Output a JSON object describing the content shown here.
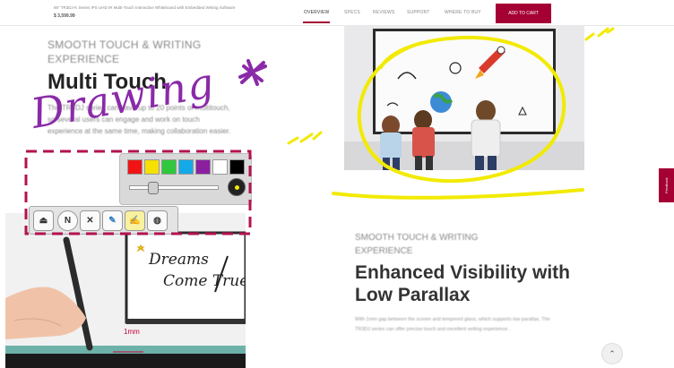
{
  "header": {
    "product_title": "86\" TR3DJ-K Series IPS UHD IR Multi-Touch Interactive Whiteboard with Embedded Writing Software",
    "price": "$ 3,599.99",
    "tabs": [
      "OVERVIEW",
      "SPECS",
      "REVIEWS",
      "SUPPORT",
      "WHERE TO BUY"
    ],
    "cart_label": "ADD TO CART"
  },
  "section1": {
    "eyebrow": "SMOOTH TOUCH & WRITING EXPERIENCE",
    "headline": "Multi Touch",
    "body": "The TR3DJ series can have up to 20 points of multitouch, so several users can engage and work on touch experience at the same time, making collaboration easier."
  },
  "section2": {
    "eyebrow": "SMOOTH TOUCH & WRITING EXPERIENCE",
    "headline": "Enhanced Visibility with Low Parallax",
    "body": "With 1mm gap between the screen and tempered glass, which supports low parallax, The TR3DJ series can offer precise touch and excellent writing experience."
  },
  "annotation": {
    "text": "Drawing"
  },
  "palette": {
    "colors": [
      "#f01414",
      "#f5e000",
      "#2fc83c",
      "#13a9e6",
      "#8b1fa0",
      "#ffffff",
      "#000000"
    ],
    "slider_level": 0.25
  },
  "toolbar": {
    "tools": [
      {
        "name": "eraser-tool-icon",
        "glyph": "⏏"
      },
      {
        "name": "notes-tool-icon",
        "glyph": "N"
      },
      {
        "name": "tools-icon",
        "glyph": "✕"
      },
      {
        "name": "highlighter-icon",
        "glyph": "✎"
      },
      {
        "name": "pen-tool-icon",
        "glyph": "✍"
      },
      {
        "name": "mouse-icon",
        "glyph": "◍"
      }
    ]
  },
  "demo": {
    "board_text_line1": "Dreams",
    "board_text_line2": "Come True",
    "gap_label": "1mm"
  },
  "feedback_label": "Feedback",
  "scroll_top_glyph": "⌃",
  "colors": {
    "brand": "#a50034",
    "annotation_purple": "#8a2aa8",
    "annotation_yellow": "#f2ea00",
    "annotation_magenta": "#b3124f"
  }
}
